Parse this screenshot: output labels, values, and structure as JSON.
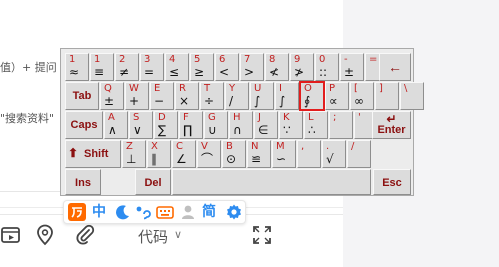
{
  "page": {
    "fragment_value": "值）+ 提问",
    "fragment_search": "\"搜索资料\""
  },
  "editor": {
    "code_label": "代码",
    "code_caret": "∨",
    "tools": [
      "video-icon",
      "location-pin-icon",
      "paperclip-icon"
    ]
  },
  "keyboard": {
    "rows": [
      [
        {
          "top": "1",
          "bot": "≈"
        },
        {
          "top": "1",
          "bot": "≡"
        },
        {
          "top": "2",
          "bot": "≠"
        },
        {
          "top": "3",
          "bot": "="
        },
        {
          "top": "4",
          "bot": "≤"
        },
        {
          "top": "5",
          "bot": "≥"
        },
        {
          "top": "6",
          "bot": "<"
        },
        {
          "top": "7",
          "bot": ">"
        },
        {
          "top": "8",
          "bot": "≮"
        },
        {
          "top": "9",
          "bot": "≯"
        },
        {
          "top": "0",
          "bot": "::"
        },
        {
          "top": "-",
          "bot": "±"
        },
        {
          "top": "=",
          "bot": ""
        }
      ],
      [
        {
          "top": "Q",
          "bot": "±"
        },
        {
          "top": "W",
          "bot": "+"
        },
        {
          "top": "E",
          "bot": "−"
        },
        {
          "top": "R",
          "bot": "×"
        },
        {
          "top": "T",
          "bot": "÷"
        },
        {
          "top": "Y",
          "bot": "/"
        },
        {
          "top": "U",
          "bot": "∫"
        },
        {
          "top": "I",
          "bot": "∫"
        },
        {
          "top": "O",
          "bot": "∮"
        },
        {
          "top": "P",
          "bot": "∝"
        },
        {
          "top": "[",
          "bot": "∞"
        },
        {
          "top": "]",
          "bot": ""
        },
        {
          "top": "\\",
          "bot": ""
        }
      ],
      [
        {
          "top": "A",
          "bot": "∧"
        },
        {
          "top": "S",
          "bot": "∨"
        },
        {
          "top": "D",
          "bot": "∑"
        },
        {
          "top": "F",
          "bot": "∏"
        },
        {
          "top": "G",
          "bot": "∪"
        },
        {
          "top": "H",
          "bot": "∩"
        },
        {
          "top": "J",
          "bot": "∈"
        },
        {
          "top": "K",
          "bot": "∵"
        },
        {
          "top": "L",
          "bot": "∴"
        },
        {
          "top": ";",
          "bot": ""
        },
        {
          "top": "'",
          "bot": ""
        }
      ],
      [
        {
          "top": "Z",
          "bot": "⊥"
        },
        {
          "top": "X",
          "bot": "∥"
        },
        {
          "top": "C",
          "bot": "∠"
        },
        {
          "top": "V",
          "bot": "⌒"
        },
        {
          "top": "B",
          "bot": "⊙"
        },
        {
          "top": "N",
          "bot": "≌"
        },
        {
          "top": "M",
          "bot": "∽"
        },
        {
          "top": ",",
          "bot": ""
        },
        {
          "top": ".",
          "bot": "√"
        },
        {
          "top": "/",
          "bot": ""
        }
      ]
    ],
    "fn": {
      "backspace": "←",
      "tab": "Tab",
      "caps": "Caps",
      "enter": "Enter",
      "enter_arrow": "↵",
      "shift": "Shift",
      "shift_arrow": "⬆",
      "ins": "Ins",
      "del": "Del",
      "esc": "Esc"
    },
    "selected_key": "O",
    "colors": {
      "primary": "#c22121",
      "secondary": "#111111",
      "selection": "#e21d1d"
    }
  },
  "ime": {
    "items": [
      "ime-logo-icon",
      "中",
      "moon-icon",
      "punctuation-icon",
      "keyboard-icon",
      "user-icon",
      "简",
      "gear-icon"
    ],
    "chinese_label": "中",
    "simplified_label": "简",
    "brand_color": "#ff6a00",
    "accent_color": "#2d8cf0"
  }
}
